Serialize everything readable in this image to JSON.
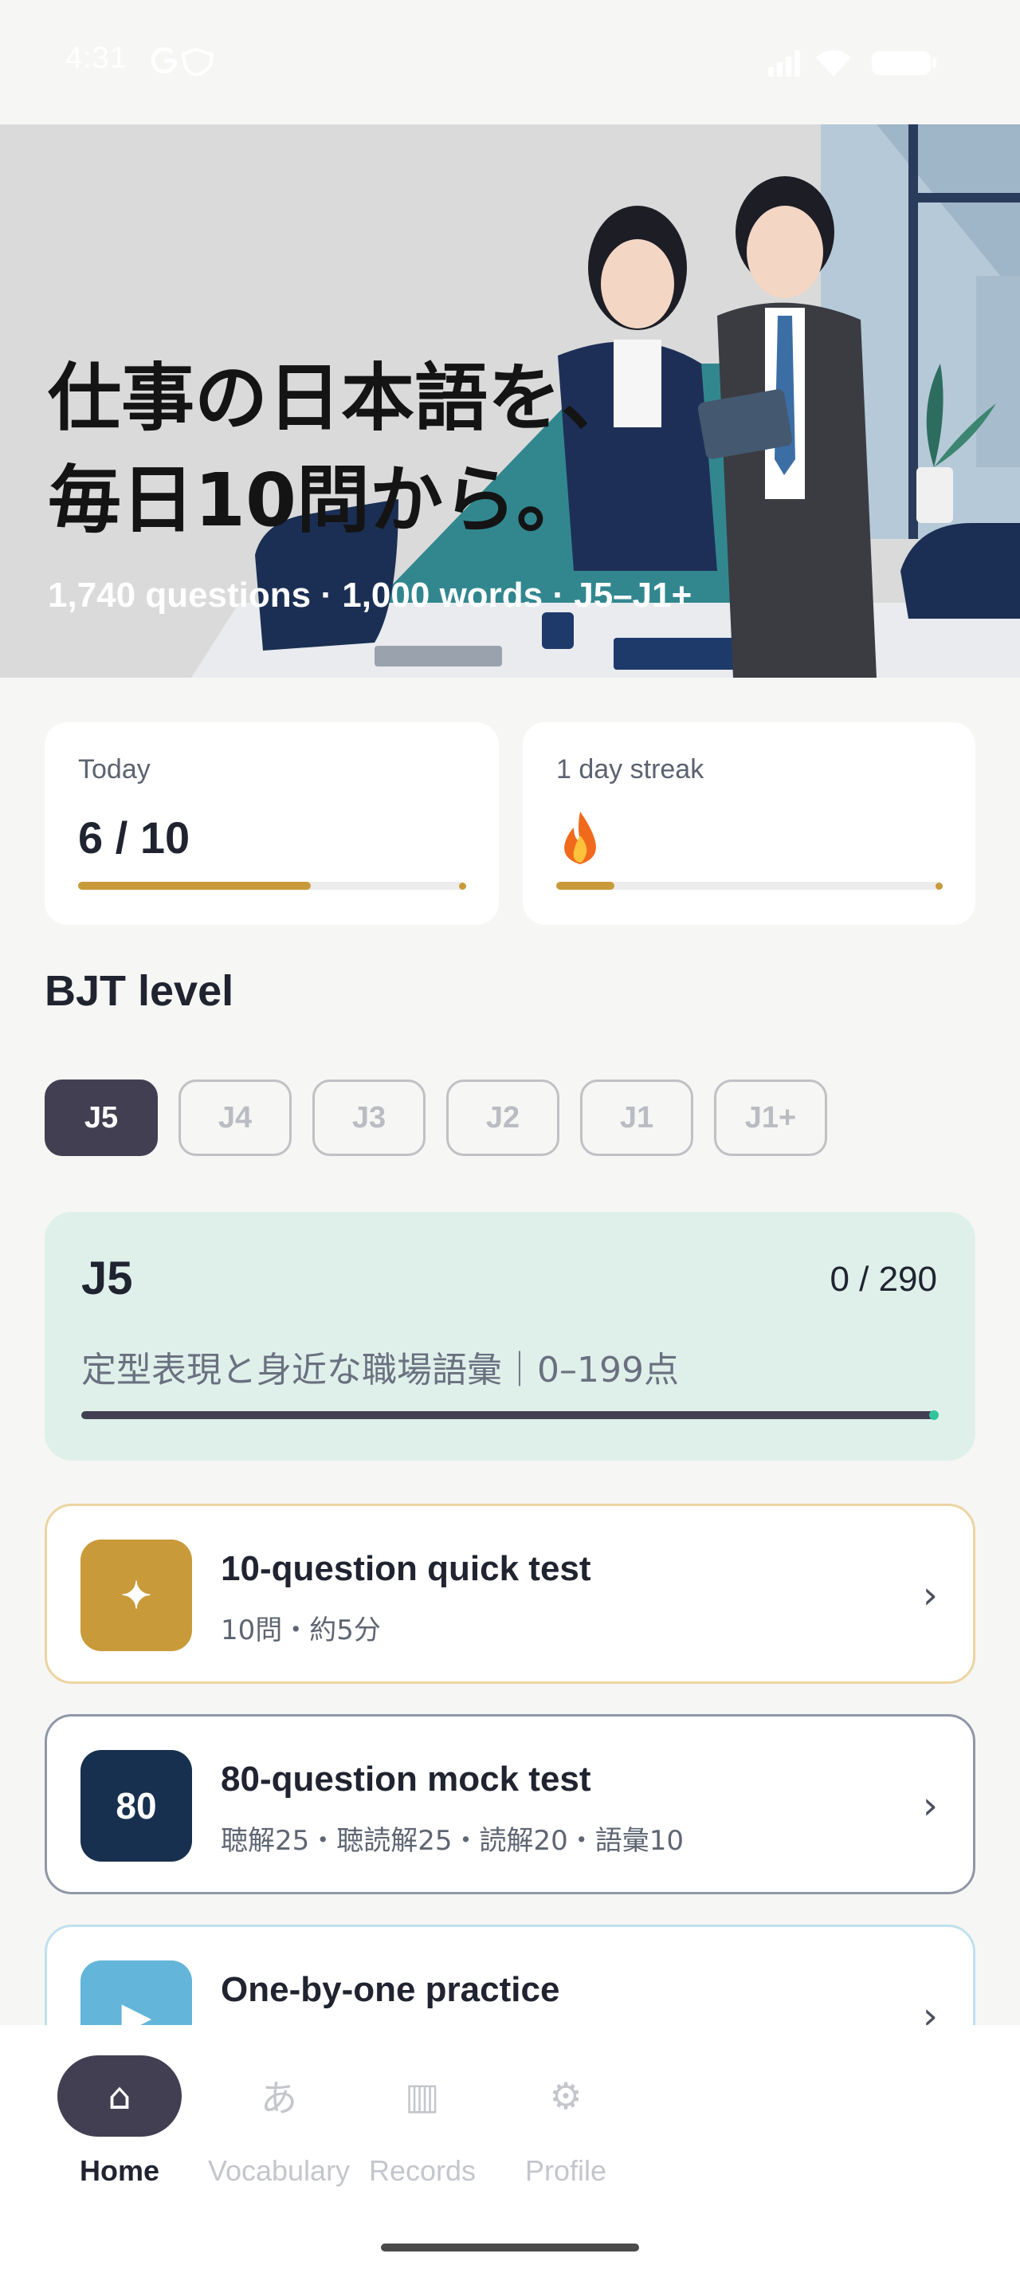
{
  "status_bar": {
    "time": "4:31",
    "icons": [
      "google-icon",
      "shield-icon",
      "signal-icon",
      "wifi-icon",
      "battery-icon"
    ]
  },
  "hero": {
    "title": "仕事の日本語を、\n毎日10問から。",
    "subtitle": "1,740 questions · 1,000 words · J5–J1+"
  },
  "today_card": {
    "label": "Today",
    "value": "6 / 10",
    "progress": 0.6
  },
  "streak_card": {
    "label": "1 day streak",
    "icon": "fire-icon",
    "progress": 0.15
  },
  "bjt_level": {
    "title": "BJT level",
    "levels": [
      "J5",
      "J4",
      "J3",
      "J2",
      "J1",
      "J1+"
    ],
    "selected": "J5"
  },
  "level_card": {
    "name": "J5",
    "progress": "0 / 290",
    "description": "定型表現と身近な職場語彙｜0–199点"
  },
  "actions": [
    {
      "title": "10-question quick test",
      "subtitle": "10問・約5分",
      "icon": "sparkle-icon",
      "icon_text": "✦",
      "color": "#c99a3a"
    },
    {
      "title": "80-question mock test",
      "subtitle": "聴解25・聴読解25・読解20・語彙10",
      "icon": "80-badge",
      "icon_text": "80",
      "color": "#17304f"
    },
    {
      "title": "One-by-one practice",
      "subtitle": "",
      "icon": "play-icon",
      "icon_text": "▶",
      "color": "#63b5d9"
    }
  ],
  "bottom_nav": {
    "items": [
      {
        "label": "Home",
        "icon": "home-icon",
        "glyph": "⌂"
      },
      {
        "label": "Vocabulary",
        "icon": "hiragana-a-icon",
        "glyph": "あ"
      },
      {
        "label": "Records",
        "icon": "records-icon",
        "glyph": "▥"
      },
      {
        "label": "Profile",
        "icon": "gear-icon",
        "glyph": "⚙"
      }
    ],
    "active": "Home"
  },
  "colors": {
    "accent_gold": "#c99a3a",
    "dark_purple": "#433f52",
    "mint_card": "#dff0ea",
    "navy": "#17304f"
  }
}
